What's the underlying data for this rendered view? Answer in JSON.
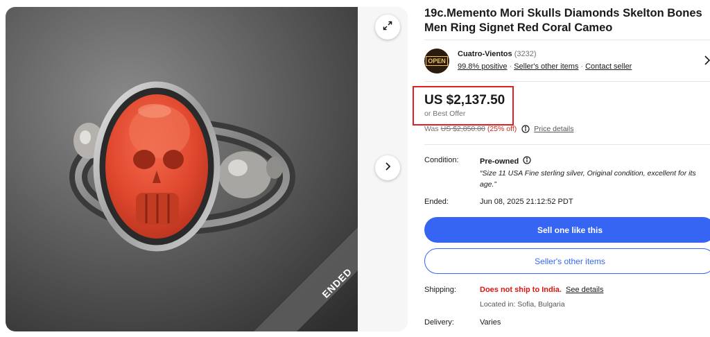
{
  "listing": {
    "title": "19c.Memento Mori Skulls Diamonds Skelton Bones Men Ring Signet Red Coral Cameo",
    "ended_banner": "ENDED"
  },
  "seller": {
    "logo_text": "OPEN",
    "name": "Cuatro-Vientos",
    "feedback_count": "(3232)",
    "positive": "99.8% positive",
    "other_items_link": "Seller's other items",
    "contact_link": "Contact seller",
    "separator": "·"
  },
  "price": {
    "current": "US $2,137.50",
    "best_offer": "or Best Offer",
    "was_label": "Was",
    "was_price": "US $2,850.00",
    "discount": "(25% off)",
    "details_link": "Price details"
  },
  "condition": {
    "label": "Condition:",
    "value": "Pre-owned",
    "description": "“Size 11 USA Fine sterling silver, Original condition, excellent for its age.”"
  },
  "ended": {
    "label": "Ended:",
    "value": "Jun 08, 2025 21:12:52 PDT"
  },
  "buttons": {
    "sell_like_this": "Sell one like this",
    "sellers_other_items": "Seller's other items"
  },
  "shipping": {
    "label": "Shipping:",
    "warning": "Does not ship to India.",
    "see_details": "See details",
    "location": "Located in: Sofia, Bulgaria"
  },
  "delivery": {
    "label": "Delivery:",
    "value": "Varies"
  },
  "colors": {
    "primary_blue": "#3665f3",
    "warning_red": "#e0130e",
    "highlight_box": "#e02020",
    "coral": "#e8543a"
  },
  "icons": [
    "expand-icon",
    "chevron-right-icon",
    "info-icon"
  ]
}
